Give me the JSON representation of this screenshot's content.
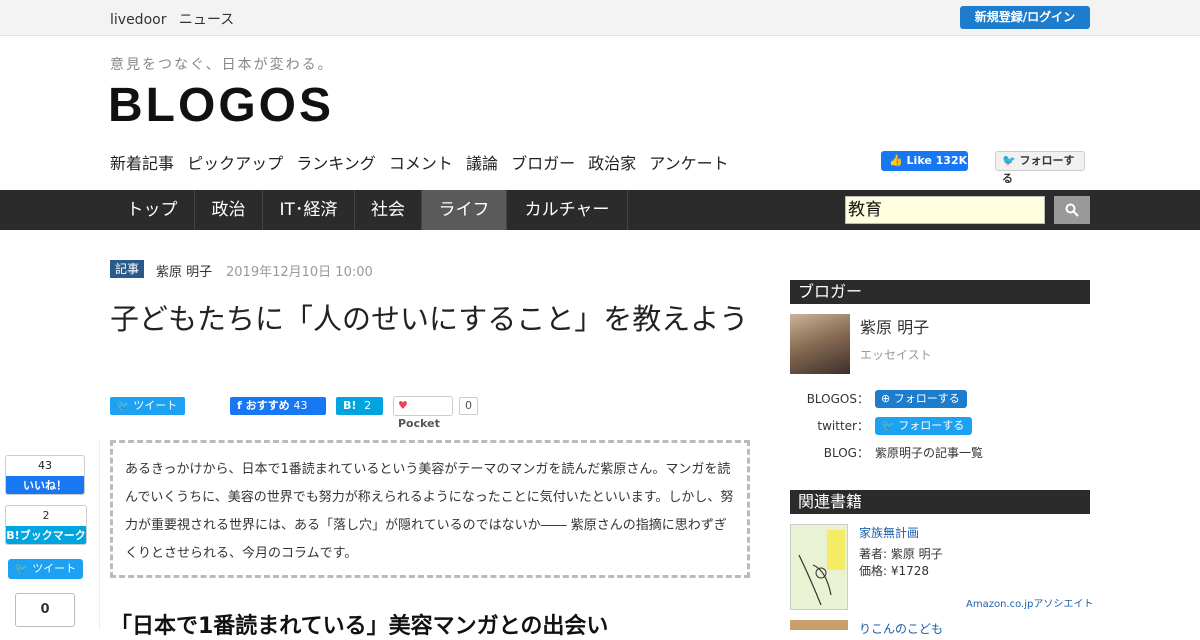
{
  "header": {
    "brand": [
      "livedoor",
      "ニュース"
    ],
    "login": "新規登録/ログイン",
    "tagline": "意見をつなぐ、日本が変わる。",
    "logo": "BLOGOS",
    "subnav": [
      "新着記事",
      "ピックアップ",
      "ランキング",
      "コメント",
      "議論",
      "ブロガー",
      "政治家",
      "アンケート"
    ],
    "fb_like": "Like 132K",
    "tw_follow": "フォローする"
  },
  "categories": [
    "トップ",
    "政治",
    "IT･経済",
    "社会",
    "ライフ",
    "カルチャー"
  ],
  "active_category": "ライフ",
  "search": {
    "value": "教育"
  },
  "article": {
    "tag": "記事",
    "author": "紫原 明子",
    "date": "2019年12月10日 10:00",
    "title": "子どもたちに「人のせいにすること」を教えよう",
    "share": {
      "tweet": "ツイート",
      "fb_recommend": "おすすめ",
      "fb_count": "43",
      "hatena": "B!",
      "hatena_count": "2",
      "pocket": "Pocket",
      "pocket_count": "0"
    },
    "lead": "あるきっかけから、日本で1番読まれているという美容がテーマのマンガを読んだ紫原さん。マンガを読んでいくうちに、美容の世界でも努力が称えられるようになったことに気付いたといいます。しかし、努力が重要視される世界には、ある「落し穴」が隠れているのではないか―― 紫原さんの指摘に思わずぎくりとさせられる、今月のコラムです。",
    "h2": "「日本で1番読まれている」美容マンガとの出会い"
  },
  "floating_share": {
    "fb_count": "43",
    "fb_label": "いいね！",
    "hb_count": "2",
    "hb_label": "B!ブックマーク",
    "tweet": "ツイート",
    "pocket_count": "0"
  },
  "sidebar": {
    "blogger_heading": "ブロガー",
    "blogger_name": "紫原 明子",
    "blogger_role": "エッセイスト",
    "blogos_label": "BLOGOS：",
    "blogos_follow": "フォローする",
    "twitter_label": "twitter：",
    "twitter_follow": "フォローする",
    "blog_label": "BLOG：",
    "blog_link": "紫原明子の記事一覧",
    "books_heading": "関連書籍",
    "book_title": "家族無計画",
    "book_author": "著者: 紫原 明子",
    "book_price": "価格: ¥1728",
    "amazon": "Amazon.co.jpアソシエイト",
    "book2_title": "りこんのこども"
  }
}
